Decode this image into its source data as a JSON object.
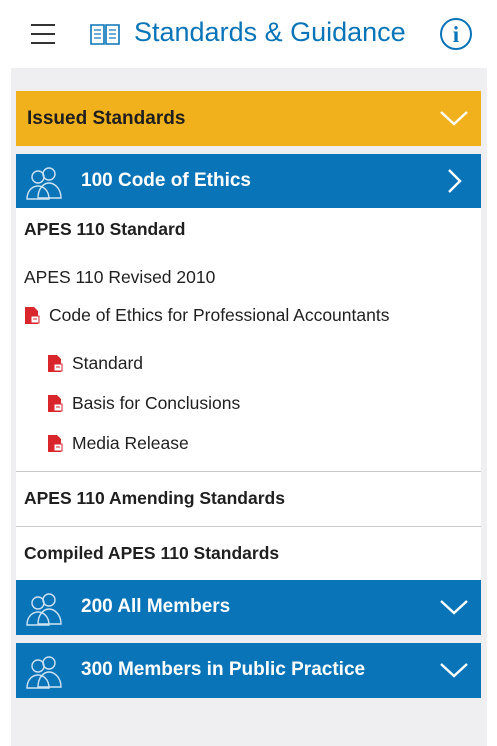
{
  "header": {
    "title": "Standards & Guidance",
    "menu_icon": "hamburger-menu-icon",
    "book_icon": "book-icon",
    "info_icon": "info-icon",
    "info_glyph": "i"
  },
  "sections": {
    "issued": {
      "label": "Issued Standards",
      "color": "#f0b11c"
    },
    "code_of_ethics": {
      "label": "100 Code of Ethics",
      "color": "#0a74b9"
    },
    "all_members": {
      "label": "200 All Members"
    },
    "public_practice": {
      "label": "300 Members in Public Practice"
    }
  },
  "code_of_ethics_items": {
    "heading": "APES 110 Standard",
    "revised": "APES 110 Revised 2010",
    "document": "Code of Ethics for Professional Accountants",
    "files": [
      "Standard",
      "Basis for Conclusions",
      "Media Release"
    ],
    "amending": "APES 110 Amending Standards",
    "compiled": "Compiled APES 110 Standards"
  }
}
